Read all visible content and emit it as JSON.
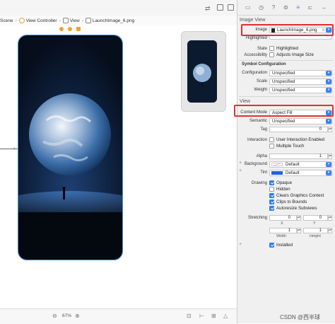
{
  "breadcrumb": {
    "items": [
      "Scene",
      "View Controller",
      "View",
      "LaunchImage_6.png"
    ]
  },
  "bottom_bar": {
    "zoom": "67%"
  },
  "inspector": {
    "image_view_title": "Image View",
    "image_label": "Image",
    "image_value": "LaunchImage_6.png",
    "highlighted_label": "Highlighted",
    "state_label": "State",
    "state_checkbox": "Highlighted",
    "accessibility_label": "Accessibility",
    "accessibility_checkbox": "Adjusts Image Size",
    "symbol_config_title": "Symbol Configuration",
    "configuration_label": "Configuration",
    "configuration_value": "Unspecified",
    "scale_label": "Scale",
    "scale_value": "Unspecified",
    "weight_label": "Weight",
    "weight_value": "Unspecified",
    "view_title": "View",
    "content_mode_label": "Content Mode",
    "content_mode_value": "Aspect Fill",
    "semantic_label": "Semantic",
    "semantic_value": "Unspecified",
    "tag_label": "Tag",
    "tag_value": "0",
    "interaction_label": "Interaction",
    "interaction_user": "User Interaction Enabled",
    "interaction_multi": "Multiple Touch",
    "alpha_label": "Alpha",
    "alpha_value": "1",
    "background_label": "Background",
    "background_value": "Default",
    "tint_label": "Tint",
    "tint_value": "Default",
    "drawing_label": "Drawing",
    "drawing_opaque": "Opaque",
    "drawing_hidden": "Hidden",
    "drawing_clears": "Clears Graphics Context",
    "drawing_clips": "Clips to Bounds",
    "drawing_autoresize": "Autoresize Subviews",
    "stretching_label": "Stretching",
    "stretch_x": "0",
    "stretch_y": "0",
    "stretch_x_label": "X",
    "stretch_y_label": "Y",
    "stretch_w": "1",
    "stretch_h": "1",
    "width_label": "Width",
    "height_label": "Height",
    "installed_label": "Installed"
  },
  "watermark": "CSDN @西半球",
  "colors": {
    "accent": "#2f7bf0",
    "highlight_box": "#e23030",
    "tint": "#1f63d8"
  }
}
